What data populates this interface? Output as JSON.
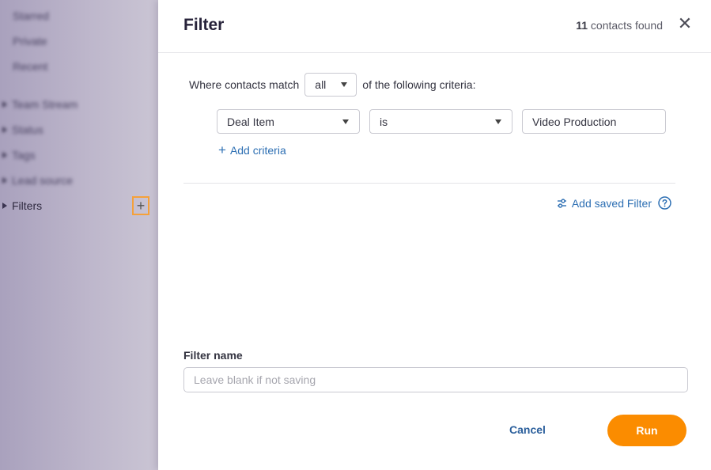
{
  "sidebar": {
    "items": [
      {
        "label": "Starred"
      },
      {
        "label": "Private"
      },
      {
        "label": "Recent"
      },
      {
        "label": "Team Stream"
      },
      {
        "label": "Status"
      },
      {
        "label": "Tags"
      },
      {
        "label": "Lead source"
      },
      {
        "label": "Filters"
      }
    ],
    "add_icon": "plus-icon",
    "add_glyph": "+"
  },
  "panel": {
    "title": "Filter",
    "contacts_count": "11",
    "contacts_suffix": " contacts found",
    "close_glyph": "✕",
    "match": {
      "prefix": "Where contacts match",
      "selected": "all",
      "suffix": "of the following criteria:"
    },
    "criteria": [
      {
        "field": "Deal Item",
        "operator": "is",
        "value": "Video Production"
      }
    ],
    "add_criteria_label": "Add criteria",
    "add_saved_filter_label": "Add saved Filter",
    "filter_name": {
      "label": "Filter name",
      "placeholder": "Leave blank if not saving",
      "value": ""
    },
    "cancel_label": "Cancel",
    "run_label": "Run"
  },
  "colors": {
    "accent_orange": "#fb8c00",
    "link_blue": "#2d6fb3",
    "highlight_border": "#f5a13a"
  }
}
